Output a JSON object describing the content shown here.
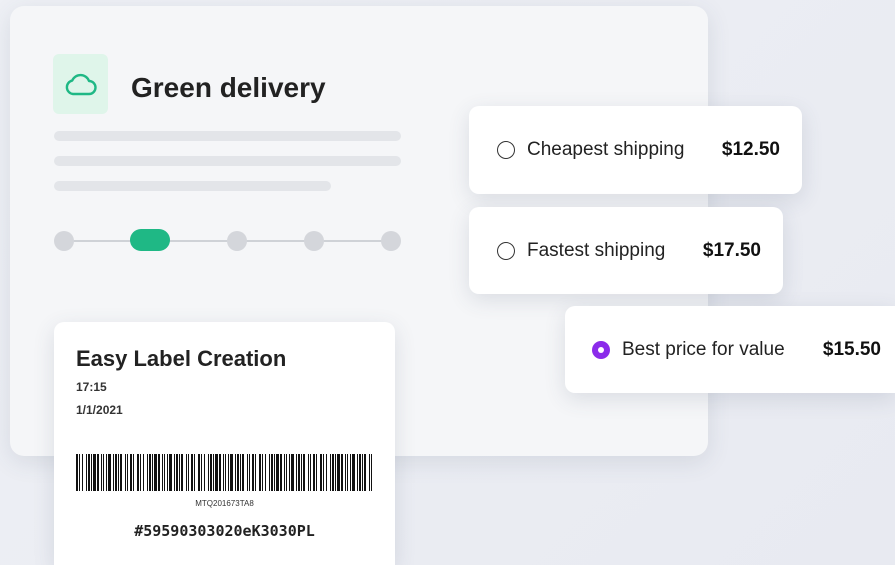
{
  "header": {
    "title": "Green delivery",
    "icon": "cloud-icon",
    "accent_color": "#1fb885"
  },
  "progress": {
    "steps": 5,
    "active_step": 2
  },
  "shipping_options": [
    {
      "label": "Cheapest shipping",
      "price": "$12.50",
      "selected": false
    },
    {
      "label": "Fastest shipping",
      "price": "$17.50",
      "selected": false
    },
    {
      "label": "Best price for value",
      "price": "$15.50",
      "selected": true
    }
  ],
  "selected_color": "#8b2bea",
  "label": {
    "title": "Easy Label Creation",
    "time": "17:15",
    "date": "1/1/2021",
    "barcode_text": "MTQ201673TA8",
    "tracking_number": "#59590303020eK3030PL"
  }
}
